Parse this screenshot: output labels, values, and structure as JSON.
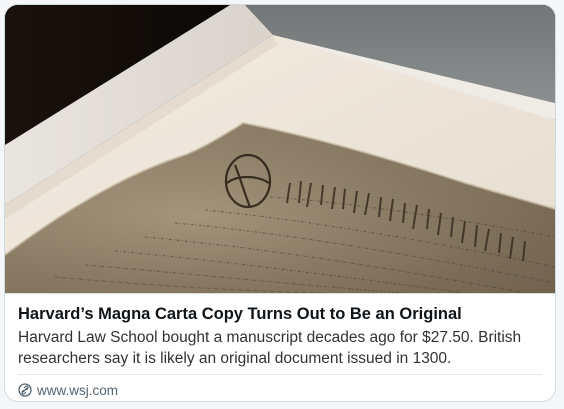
{
  "card": {
    "image_alt": "Magna Carta manuscript in a display box",
    "headline": "Harvard’s Magna Carta Copy Turns Out to Be an Original",
    "description": "Harvard Law School bought a manuscript decades ago for $27.50. British researchers say it is likely an original document issued in 1300.",
    "source_icon": "link-icon",
    "domain": "www.wsj.com"
  },
  "colors": {
    "headline": "#0f1419",
    "description": "#2f3336",
    "domain": "#536471",
    "border": "#cfd9de"
  }
}
